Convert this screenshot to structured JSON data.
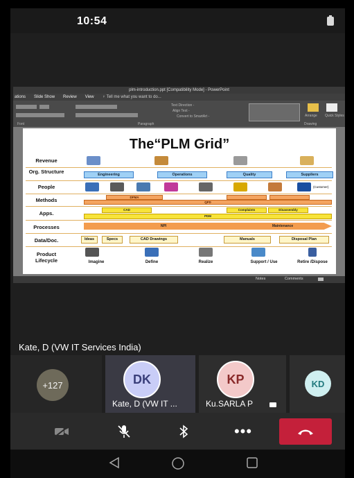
{
  "status_bar": {
    "time": "10:54"
  },
  "ppt": {
    "title": "plm-introduction.ppt [Compatibility Mode] - PowerPoint",
    "menu": [
      "ations",
      "Slide Show",
      "Review",
      "View",
      "♀ Tell me what you want to do..."
    ],
    "ribbon": {
      "font_group": "Font",
      "paragraph_group": "Paragraph",
      "drawing_group": "Drawing",
      "text_direction": "Text Direction -",
      "align_text": "Align Text -",
      "convert_smartart": "Convert to SmartArt -",
      "arrange": "Arrange",
      "quick_styles": "Quick Styles"
    },
    "status": {
      "notes": "Notes",
      "comments": "Comments"
    }
  },
  "slide": {
    "title": "The“PLM Grid”",
    "rows": {
      "revenue": "Revenue",
      "org_structure": "Org. Structure",
      "people": "People",
      "methods": "Methods",
      "apps": "Apps.",
      "processes": "Processes",
      "data_doc": "Data/Doc.",
      "product_lifecycle": "Product Lifecycle"
    },
    "org_boxes": [
      "Engineering",
      "Operations",
      "Quality",
      "Suppliers"
    ],
    "people_customer": "(Customer)",
    "methods_bars": [
      "DFMA",
      "QFD"
    ],
    "apps_bars": [
      "CAD",
      "Complaints",
      "Disassembly",
      "PDM"
    ],
    "process_arrows": [
      "NPI",
      "Maintenance"
    ],
    "doc_boxes": [
      "Ideas",
      "Specs",
      "CAD Drawings",
      "Manuals",
      "Disposal Plan"
    ],
    "lifecycle_stages": [
      "Imagine",
      "Define",
      "Realize",
      "Support / Use",
      "Retire /Dispose"
    ]
  },
  "presenter": {
    "name": "Kate, D (VW IT Services India)"
  },
  "participants": {
    "overflow_count": "+127",
    "tile1": {
      "initials": "DK",
      "label": "Kate, D (VW IT ..."
    },
    "tile2": {
      "initials": "KP",
      "label": "Ku.SARLA P"
    },
    "tile3": {
      "initials": "KD"
    }
  },
  "colors": {
    "end_call": "#c4203a",
    "avatar_dk_bg": "#c9cdf7",
    "avatar_kp_bg": "#f3c9c9",
    "avatar_kd_bg": "#cfeff0"
  }
}
